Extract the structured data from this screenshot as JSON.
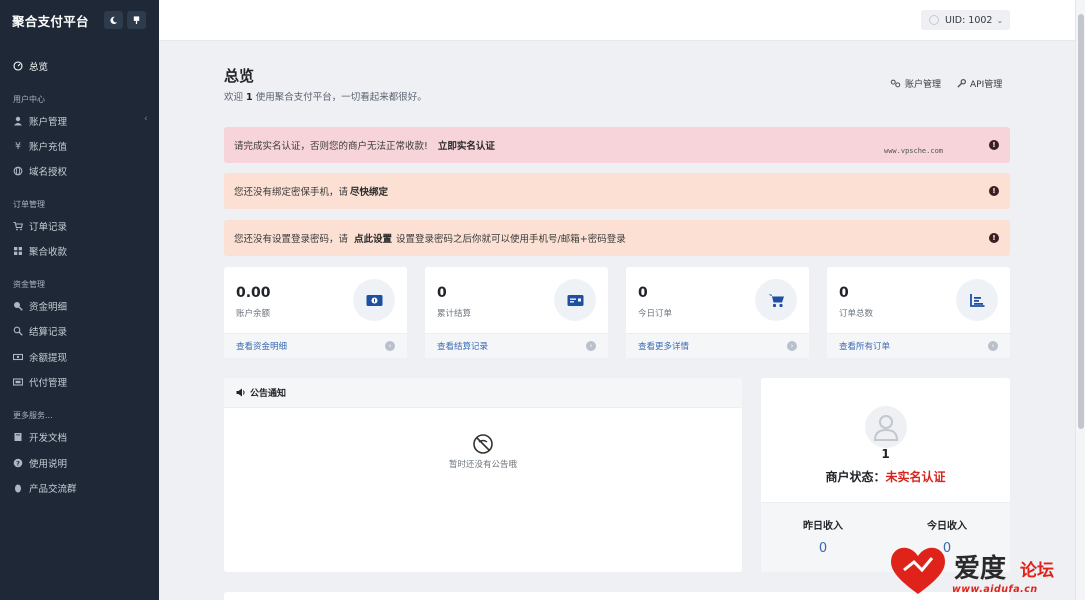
{
  "app": {
    "title": "聚合支付平台"
  },
  "sidebar": {
    "overview": "总览",
    "groups": [
      {
        "label": "用户中心",
        "items": [
          "账户管理",
          "账户充值",
          "域名授权"
        ]
      },
      {
        "label": "订单管理",
        "items": [
          "订单记录",
          "聚合收款"
        ]
      },
      {
        "label": "资金管理",
        "items": [
          "资金明细",
          "结算记录",
          "余额提现",
          "代付管理"
        ]
      },
      {
        "label": "更多服务...",
        "items": [
          "开发文档",
          "使用说明",
          "产品交流群"
        ]
      }
    ]
  },
  "topbar": {
    "uid_label": "UID: 1002"
  },
  "header": {
    "title": "总览",
    "welcome_prefix": "欢迎",
    "welcome_uid": "1",
    "welcome_suffix": "使用聚合支付平台，一切看起来都很好。",
    "links": [
      "账户管理",
      "API管理"
    ]
  },
  "alerts": [
    {
      "text": "请完成实名认证，否则您的商户无法正常收款!",
      "action": "立即实名认证",
      "tail": ""
    },
    {
      "text": "您还没有绑定密保手机，请",
      "action": "尽快绑定",
      "tail": ""
    },
    {
      "text": "您还没有设置登录密码，请",
      "action": "点此设置",
      "tail": "设置登录密码之后你就可以使用手机号/邮箱+密码登录"
    }
  ],
  "watermark_text": "www.vpsche.com",
  "stats": [
    {
      "value": "0.00",
      "label": "账户余额",
      "link": "查看资金明细",
      "icon": "money-icon"
    },
    {
      "value": "0",
      "label": "累计结算",
      "link": "查看结算记录",
      "icon": "card-icon"
    },
    {
      "value": "0",
      "label": "今日订单",
      "link": "查看更多详情",
      "icon": "cart-icon"
    },
    {
      "value": "0",
      "label": "订单总数",
      "link": "查看所有订单",
      "icon": "bar-chart-icon"
    }
  ],
  "notice": {
    "title": "公告通知",
    "empty": "暂时还没有公告哦"
  },
  "profile": {
    "uid": "1",
    "status_label": "商户状态：",
    "status_value": "未实名认证",
    "yesterday_label": "昨日收入",
    "yesterday_value": "0",
    "today_label": "今日收入",
    "today_value": "0"
  },
  "site_logo": {
    "cn": "爱度",
    "cn2": "论坛",
    "url": "www.aidufa.cn"
  },
  "colors": {
    "sidebar_bg": "#1e2836",
    "accent_blue": "#1f4fa3",
    "danger_text": "#d9241c"
  }
}
